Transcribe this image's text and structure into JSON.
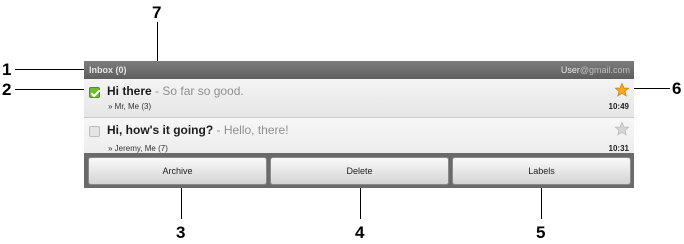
{
  "callouts": [
    "1",
    "2",
    "3",
    "4",
    "5",
    "6",
    "7"
  ],
  "titlebar": {
    "folder": "Inbox (0)",
    "account_prefix": "User",
    "account_domain": "@gmail.com"
  },
  "messages": [
    {
      "subject": "Hi there",
      "snippet": " - So far so good.",
      "participants": "» Mr, Me (3)",
      "time": "10:49",
      "checked": true,
      "starred": true
    },
    {
      "subject": "Hi, how's it going?",
      "snippet": " - Hello, there!",
      "participants": "» Jeremy, Me (7)",
      "time": "10:31",
      "checked": false,
      "starred": false
    }
  ],
  "actions": {
    "archive": "Archive",
    "delete": "Delete",
    "labels": "Labels"
  },
  "colors": {
    "checkbox_checked": "#6fbd2e",
    "star_on": "#f5a623",
    "star_off": "#c8c8c8"
  }
}
